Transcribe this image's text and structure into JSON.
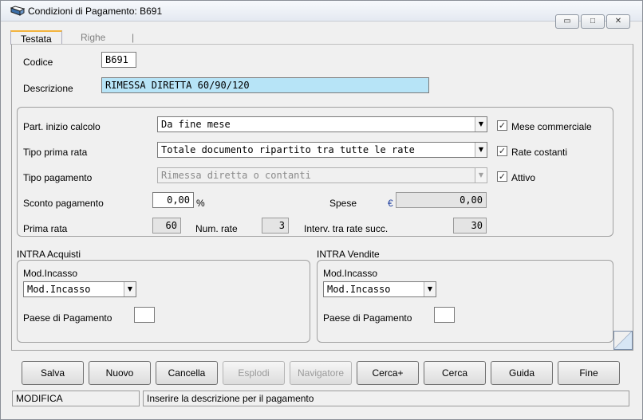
{
  "window": {
    "title": "Condizioni di Pagamento: B691",
    "btn_minimize": "▭",
    "btn_restore": "□",
    "btn_close": "✕"
  },
  "tabs": [
    {
      "label": "Testata"
    },
    {
      "label": "Righe"
    }
  ],
  "tab_separator": "|",
  "header": {
    "codice_label": "Codice",
    "codice_value": "B691",
    "descrizione_label": "Descrizione",
    "descrizione_value": "RIMESSA DIRETTA 60/90/120"
  },
  "calc": {
    "part_label": "Part. inizio calcolo",
    "part_value": "Da fine mese",
    "tipo_prima_label": "Tipo prima rata",
    "tipo_prima_value": "Totale documento ripartito tra tutte le rate",
    "tipo_pag_label": "Tipo pagamento",
    "tipo_pag_value": "Rimessa diretta o contanti",
    "sconto_label": "Sconto pagamento",
    "sconto_value": "0,00",
    "sconto_unit": "%",
    "spese_label": "Spese",
    "spese_currency": "€",
    "spese_value": "0,00",
    "prima_rata_label": "Prima rata",
    "prima_rata_value": "60",
    "num_rate_label": "Num. rate",
    "num_rate_value": "3",
    "interv_label": "Interv. tra rate succ.",
    "interv_value": "30"
  },
  "checks": {
    "mese_comm": {
      "label": "Mese commerciale",
      "checked": true,
      "mark": "✓"
    },
    "rate_cost": {
      "label": "Rate costanti",
      "checked": true,
      "mark": "✓"
    },
    "attivo": {
      "label": "Attivo",
      "checked": true,
      "mark": "✓"
    }
  },
  "intra_acq": {
    "title": "INTRA Acquisti",
    "mod_label": "Mod.Incasso",
    "mod_value": "Mod.Incasso",
    "paese_label": "Paese di Pagamento"
  },
  "intra_ven": {
    "title": "INTRA Vendite",
    "mod_label": "Mod.Incasso",
    "mod_value": "Mod.Incasso",
    "paese_label": "Paese di Pagamento"
  },
  "buttons": {
    "salva": "Salva",
    "nuovo": "Nuovo",
    "cancella": "Cancella",
    "esplodi": "Esplodi",
    "navigatore": "Navigatore",
    "cerca_plus": "Cerca+",
    "cerca": "Cerca",
    "guida": "Guida",
    "fine": "Fine"
  },
  "status": {
    "mode": "MODIFICA",
    "hint": "Inserire la descrizione per il pagamento"
  },
  "icons": {
    "app": "folder-icon",
    "dropdown": "▼"
  }
}
